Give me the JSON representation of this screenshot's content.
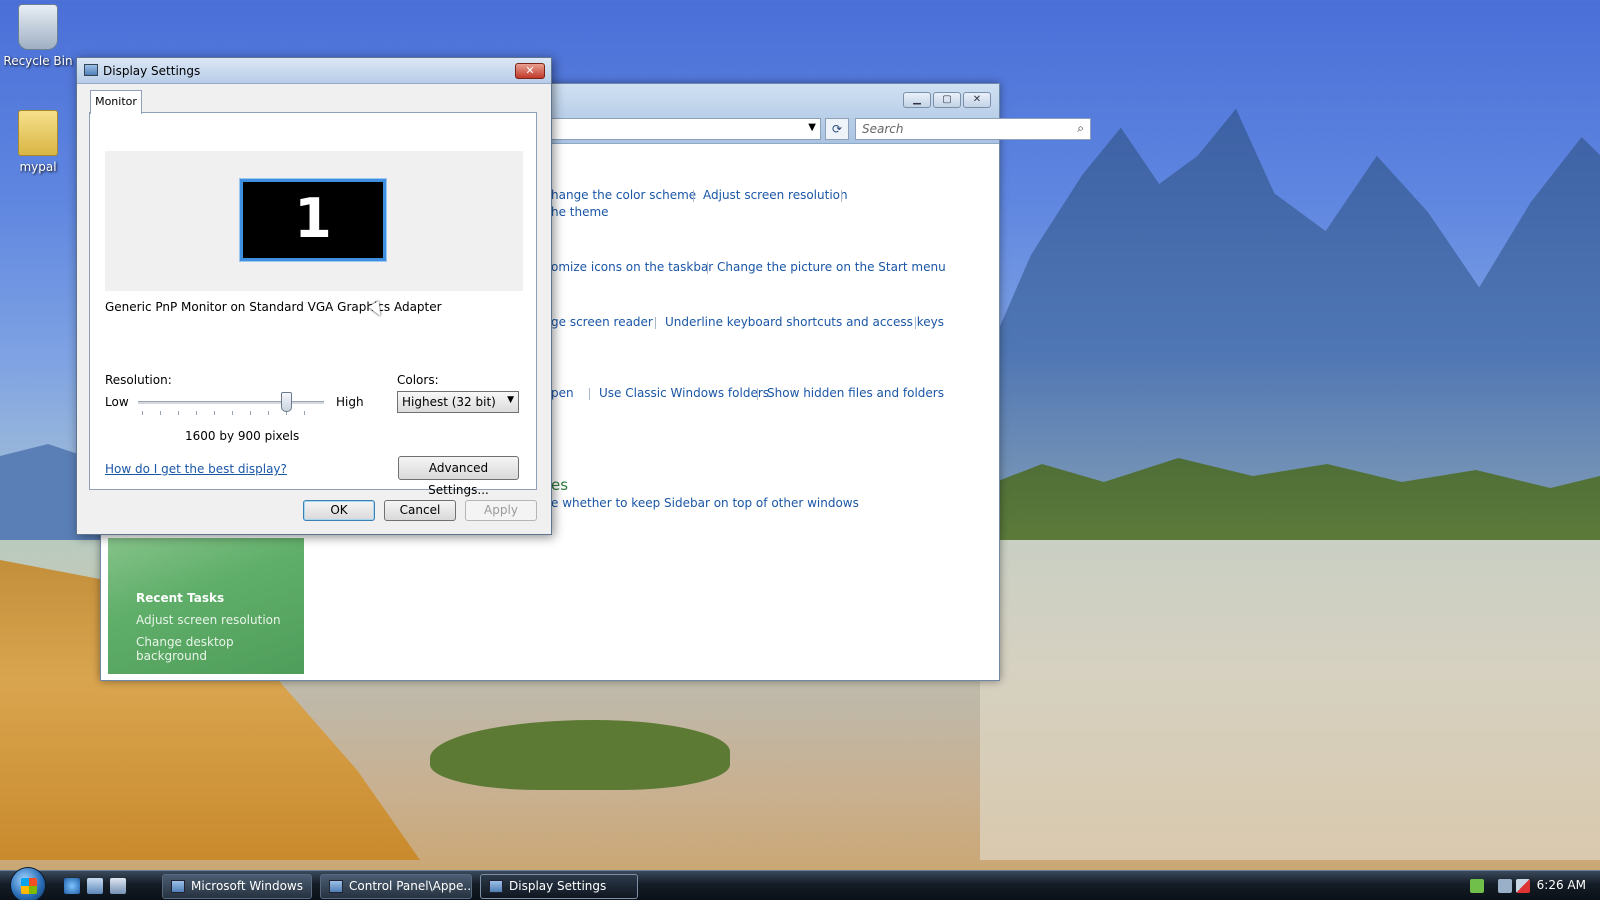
{
  "desktop": {
    "icons": [
      {
        "label": "Recycle Bin"
      },
      {
        "label": "mypal"
      }
    ]
  },
  "control_panel": {
    "search_placeholder": "Search",
    "links": {
      "change_color_scheme": "hange the color scheme",
      "adjust_resolution": "Adjust screen resolution",
      "theme": "he theme",
      "customize_taskbar": "omize icons on the taskbar",
      "change_start_picture": "Change the picture on the Start menu",
      "screen_reader": "ge screen reader",
      "underline_shortcuts": "Underline keyboard shortcuts and access keys",
      "open": "pen",
      "classic_folders": "Use Classic Windows folders",
      "hidden_files": "Show hidden files and folders",
      "sidebar_top": "e whether to keep Sidebar on top of other windows"
    },
    "section_heading": "es",
    "recent_tasks": {
      "title": "Recent Tasks",
      "items": [
        "Adjust screen resolution",
        "Change desktop background"
      ]
    }
  },
  "dialog": {
    "title": "Display Settings",
    "close_label": "✕",
    "tab_label": "Monitor",
    "monitor_number": "1",
    "monitor_description": "Generic PnP Monitor on Standard VGA Graphics Adapter",
    "resolution_label": "Resolution:",
    "low_label": "Low",
    "high_label": "High",
    "resolution_value": "1600 by 900 pixels",
    "resolution_slider_fraction": 0.8,
    "colors_label": "Colors:",
    "colors_value": "Highest (32 bit)",
    "help_link": "How do I get the best display?",
    "advanced_button": "Advanced Settings...",
    "ok_button": "OK",
    "cancel_button": "Cancel",
    "apply_button": "Apply"
  },
  "taskbar": {
    "buttons": [
      {
        "label": "Microsoft Windows"
      },
      {
        "label": "Control Panel\\Appe..."
      },
      {
        "label": "Display Settings"
      }
    ],
    "clock": "6:26 AM"
  }
}
